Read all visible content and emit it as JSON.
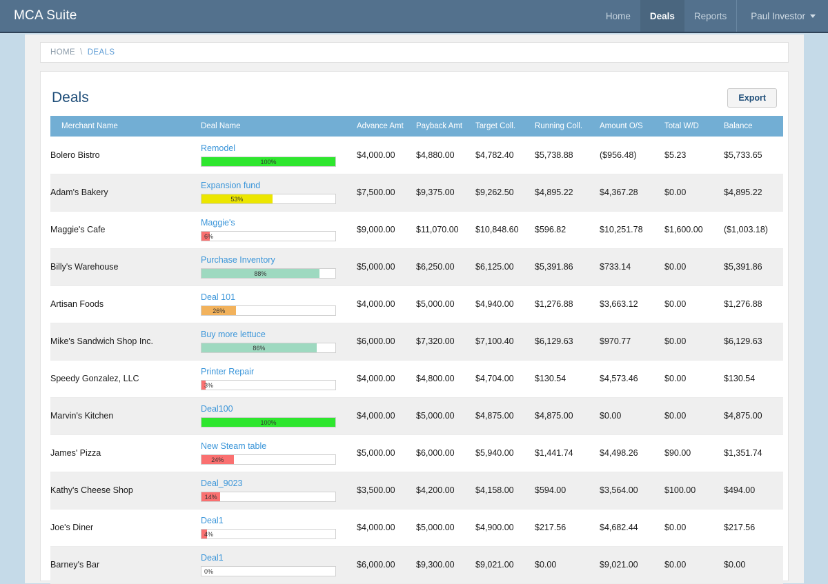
{
  "navbar": {
    "brand": "MCA Suite",
    "links": [
      {
        "label": "Home",
        "active": false
      },
      {
        "label": "Deals",
        "active": true
      },
      {
        "label": "Reports",
        "active": false
      }
    ],
    "user": "Paul Investor",
    "user_caret_icon": "chevron-down-icon"
  },
  "breadcrumb": {
    "home": "HOME",
    "separator": "\\",
    "current": "DEALS"
  },
  "panel": {
    "title": "Deals",
    "export_label": "Export"
  },
  "colors": {
    "navbar_bg": "#53718d",
    "navbar_active_bg": "#4a667f",
    "page_surround": "#c5dae8",
    "table_header_bg": "#72aed4",
    "link_blue": "#3a95d9",
    "title_blue": "#1f4e79",
    "bar_green": "#2ee62e",
    "bar_teal": "#9ed9c0",
    "bar_yellow": "#ece600",
    "bar_orange": "#f2b25c",
    "bar_red": "#fa7070",
    "row_alt_bg": "#efefef"
  },
  "table": {
    "columns": [
      "Merchant Name",
      "Deal Name",
      "Advance Amt",
      "Payback Amt",
      "Target Coll.",
      "Running Coll.",
      "Amount O/S",
      "Total W/D",
      "Balance"
    ],
    "rows": [
      {
        "merchant": "Bolero Bistro",
        "deal": "Remodel",
        "progress": 100,
        "progress_label": "100%",
        "bar_color": "#2ee62e",
        "advance": "$4,000.00",
        "payback": "$4,880.00",
        "target": "$4,782.40",
        "running": "$5,738.88",
        "outstanding": "($956.48)",
        "withdrawn": "$5.23",
        "balance": "$5,733.65"
      },
      {
        "merchant": "Adam's Bakery",
        "deal": "Expansion fund",
        "progress": 53,
        "progress_label": "53%",
        "bar_color": "#ece600",
        "advance": "$7,500.00",
        "payback": "$9,375.00",
        "target": "$9,262.50",
        "running": "$4,895.22",
        "outstanding": "$4,367.28",
        "withdrawn": "$0.00",
        "balance": "$4,895.22"
      },
      {
        "merchant": "Maggie's Cafe",
        "deal": "Maggie's",
        "progress": 6,
        "progress_label": "6%",
        "bar_color": "#fa7070",
        "advance": "$9,000.00",
        "payback": "$11,070.00",
        "target": "$10,848.60",
        "running": "$596.82",
        "outstanding": "$10,251.78",
        "withdrawn": "$1,600.00",
        "balance": "($1,003.18)"
      },
      {
        "merchant": "Billy's Warehouse",
        "deal": "Purchase Inventory",
        "progress": 88,
        "progress_label": "88%",
        "bar_color": "#9ed9c0",
        "advance": "$5,000.00",
        "payback": "$6,250.00",
        "target": "$6,125.00",
        "running": "$5,391.86",
        "outstanding": "$733.14",
        "withdrawn": "$0.00",
        "balance": "$5,391.86"
      },
      {
        "merchant": "Artisan Foods",
        "deal": "Deal 101",
        "progress": 26,
        "progress_label": "26%",
        "bar_color": "#f2b25c",
        "advance": "$4,000.00",
        "payback": "$5,000.00",
        "target": "$4,940.00",
        "running": "$1,276.88",
        "outstanding": "$3,663.12",
        "withdrawn": "$0.00",
        "balance": "$1,276.88"
      },
      {
        "merchant": "Mike's Sandwich Shop Inc.",
        "deal": "Buy more lettuce",
        "progress": 86,
        "progress_label": "86%",
        "bar_color": "#9ed9c0",
        "advance": "$6,000.00",
        "payback": "$7,320.00",
        "target": "$7,100.40",
        "running": "$6,129.63",
        "outstanding": "$970.77",
        "withdrawn": "$0.00",
        "balance": "$6,129.63"
      },
      {
        "merchant": "Speedy Gonzalez, LLC",
        "deal": "Printer Repair",
        "progress": 3,
        "progress_label": "3%",
        "bar_color": "#fa7070",
        "advance": "$4,000.00",
        "payback": "$4,800.00",
        "target": "$4,704.00",
        "running": "$130.54",
        "outstanding": "$4,573.46",
        "withdrawn": "$0.00",
        "balance": "$130.54"
      },
      {
        "merchant": "Marvin's Kitchen",
        "deal": "Deal100",
        "progress": 100,
        "progress_label": "100%",
        "bar_color": "#2ee62e",
        "advance": "$4,000.00",
        "payback": "$5,000.00",
        "target": "$4,875.00",
        "running": "$4,875.00",
        "outstanding": "$0.00",
        "withdrawn": "$0.00",
        "balance": "$4,875.00"
      },
      {
        "merchant": "James' Pizza",
        "deal": "New Steam table",
        "progress": 24,
        "progress_label": "24%",
        "bar_color": "#fa7070",
        "advance": "$5,000.00",
        "payback": "$6,000.00",
        "target": "$5,940.00",
        "running": "$1,441.74",
        "outstanding": "$4,498.26",
        "withdrawn": "$90.00",
        "balance": "$1,351.74"
      },
      {
        "merchant": "Kathy's Cheese Shop",
        "deal": "Deal_9023",
        "progress": 14,
        "progress_label": "14%",
        "bar_color": "#fa7070",
        "advance": "$3,500.00",
        "payback": "$4,200.00",
        "target": "$4,158.00",
        "running": "$594.00",
        "outstanding": "$3,564.00",
        "withdrawn": "$100.00",
        "balance": "$494.00"
      },
      {
        "merchant": "Joe's Diner",
        "deal": "Deal1",
        "progress": 4,
        "progress_label": "4%",
        "bar_color": "#fa7070",
        "advance": "$4,000.00",
        "payback": "$5,000.00",
        "target": "$4,900.00",
        "running": "$217.56",
        "outstanding": "$4,682.44",
        "withdrawn": "$0.00",
        "balance": "$217.56"
      },
      {
        "merchant": "Barney's Bar",
        "deal": "Deal1",
        "progress": 0,
        "progress_label": "0%",
        "bar_color": "#fa7070",
        "advance": "$6,000.00",
        "payback": "$9,300.00",
        "target": "$9,021.00",
        "running": "$0.00",
        "outstanding": "$9,021.00",
        "withdrawn": "$0.00",
        "balance": "$0.00"
      }
    ]
  }
}
